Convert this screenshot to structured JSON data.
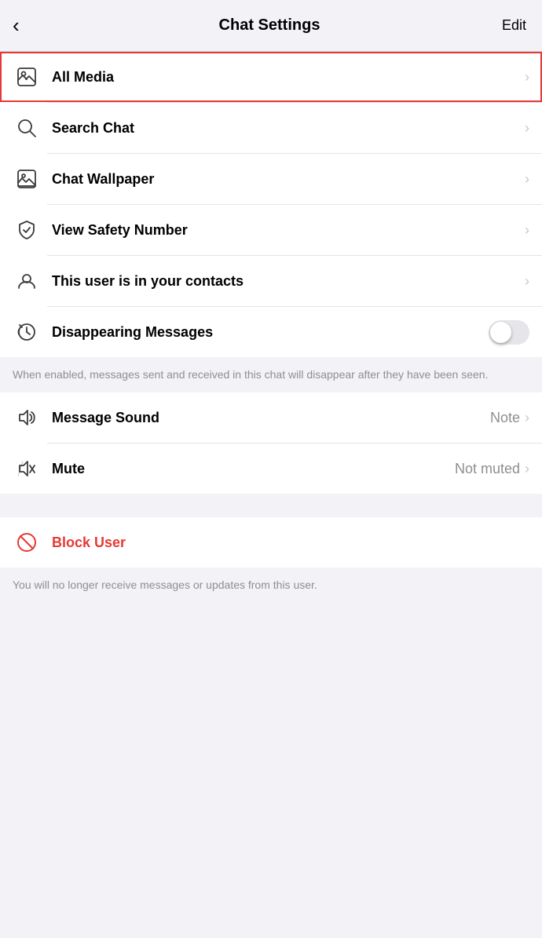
{
  "header": {
    "back_label": "‹",
    "title": "Chat Settings",
    "edit_label": "Edit"
  },
  "menu_items": [
    {
      "id": "all-media",
      "label": "All Media",
      "icon": "media-icon",
      "value": "",
      "has_chevron": true,
      "highlighted": true
    },
    {
      "id": "search-chat",
      "label": "Search Chat",
      "icon": "search-icon",
      "value": "",
      "has_chevron": true,
      "highlighted": false
    },
    {
      "id": "chat-wallpaper",
      "label": "Chat Wallpaper",
      "icon": "wallpaper-icon",
      "value": "",
      "has_chevron": true,
      "highlighted": false
    },
    {
      "id": "view-safety-number",
      "label": "View Safety Number",
      "icon": "safety-icon",
      "value": "",
      "has_chevron": true,
      "highlighted": false
    },
    {
      "id": "contacts",
      "label": "This user is in your contacts",
      "icon": "contact-icon",
      "value": "",
      "has_chevron": true,
      "highlighted": false
    }
  ],
  "disappearing_messages": {
    "label": "Disappearing Messages",
    "description": "When enabled, messages sent and received in this chat will disappear after they have been seen.",
    "enabled": false
  },
  "notification_items": [
    {
      "id": "message-sound",
      "label": "Message Sound",
      "icon": "sound-icon",
      "value": "Note",
      "has_chevron": true
    },
    {
      "id": "mute",
      "label": "Mute",
      "icon": "mute-icon",
      "value": "Not muted",
      "has_chevron": true
    }
  ],
  "block_user": {
    "label": "Block User",
    "description": "You will no longer receive messages or updates from this user.",
    "icon": "block-icon"
  }
}
